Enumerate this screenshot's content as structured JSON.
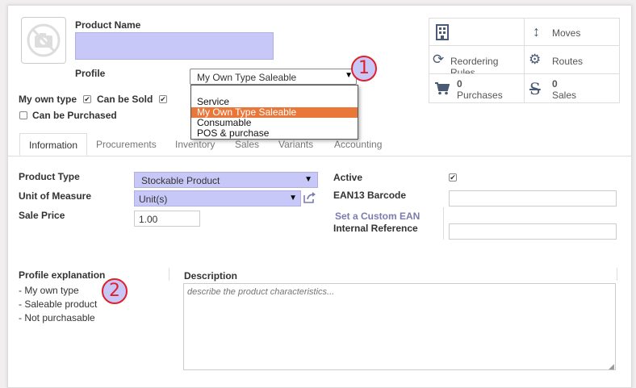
{
  "form": {
    "product_name_label": "Product Name",
    "product_name_value": "",
    "profile_label": "Profile",
    "profile_value": "My Own Type Saleable",
    "my_own_type_label": "My own type",
    "can_be_sold_label": "Can be Sold",
    "can_be_purchased_label": "Can be Purchased",
    "my_own_type_checked": true,
    "can_be_sold_checked": true,
    "can_be_purchased_checked": false
  },
  "profile_dropdown": {
    "options": [
      "Service",
      "My Own Type Saleable",
      "Consumable",
      "POS & purchase"
    ],
    "selected_index": 1
  },
  "stat_buttons": {
    "moves": "Moves",
    "reordering": "Reordering Rules",
    "routes": "Routes",
    "purchases_count": "0",
    "purchases_label": "Purchases",
    "sales_count": "0",
    "sales_label": "Sales"
  },
  "tabs": [
    "Information",
    "Procurements",
    "Inventory",
    "Sales",
    "Variants",
    "Accounting"
  ],
  "info": {
    "product_type_label": "Product Type",
    "product_type_value": "Stockable Product",
    "uom_label": "Unit of Measure",
    "uom_value": "Unit(s)",
    "sale_price_label": "Sale Price",
    "sale_price_value": "1.00",
    "active_label": "Active",
    "active_checked": true,
    "ean13_label": "EAN13 Barcode",
    "set_custom_ean": "Set a Custom EAN",
    "internal_ref_label": "Internal Reference"
  },
  "profile_explanation": {
    "title": "Profile explanation",
    "lines": [
      "- My own type",
      "- Saleable product",
      "- Not purchasable"
    ]
  },
  "description": {
    "label": "Description",
    "placeholder": "describe the product characteristics..."
  },
  "annotations": {
    "marker1": "1",
    "marker2": "2",
    "marker_color": "#e0202a"
  },
  "colors": {
    "highlight_input": "#c8c8f8",
    "selected_option": "#e9773a",
    "link": "#7c7bad"
  }
}
